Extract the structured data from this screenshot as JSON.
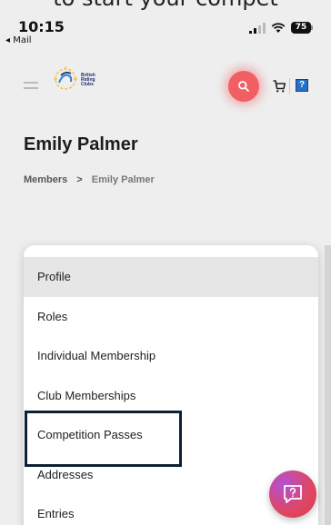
{
  "caption": "to start your compet",
  "status_bar": {
    "time": "10:15",
    "back_label": "◂ Mail",
    "battery": "75"
  },
  "header": {
    "logo_text": [
      "British",
      "Riding",
      "Clubs"
    ],
    "icons": {
      "menu": "hamburger-icon",
      "search": "search-icon",
      "cart": "cart-icon",
      "help": "help-icon"
    },
    "help_label": "?",
    "colors": {
      "search_accent": "#f15f63",
      "help_accent": "#2470c9"
    }
  },
  "page": {
    "title": "Emily Palmer",
    "breadcrumb": {
      "parent": "Members",
      "separator": ">",
      "current": "Emily Palmer"
    }
  },
  "menu": {
    "items": [
      {
        "label": "Profile",
        "active": true
      },
      {
        "label": "Roles"
      },
      {
        "label": "Individual Membership"
      },
      {
        "label": "Club Memberships"
      },
      {
        "label": "Competition Passes",
        "highlighted": true
      },
      {
        "label": "Addresses"
      },
      {
        "label": "Entries"
      }
    ]
  },
  "chat": {
    "icon": "chat-help-icon"
  }
}
